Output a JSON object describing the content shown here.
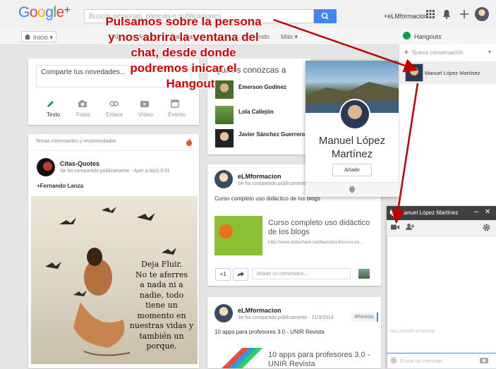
{
  "top": {
    "logo_text": "Google+",
    "search_placeholder": "Buscar personas, páginas o publicaciones",
    "username": "+eLMformacion"
  },
  "nav": {
    "home_label": "Inicio",
    "tabs": [
      "Todos",
      "Amigos",
      "Familia",
      "Conocidos",
      "Siguiendo",
      "Más"
    ],
    "hangouts_title": "Hangouts"
  },
  "compose": {
    "placeholder": "Comparte tus novedades...",
    "actions": [
      "Texto",
      "Fotos",
      "Enlace",
      "Vídeo",
      "Evento"
    ]
  },
  "trending": {
    "header": "Temas interesantes y recomendados",
    "author": "Citas-Quotes",
    "meta": "Se ha compartido públicamente · Ayer a la(s) 3:31",
    "mention": "+Fernando Lanza",
    "poem": [
      "Deja Fluir.",
      "No te aferres",
      "a nada ni a",
      "nadie, todo",
      "tiene un",
      "momento en",
      "nuestras vidas y",
      "también un",
      "porque."
    ]
  },
  "suggestions": {
    "title": "Quizás conozcas a",
    "people": [
      "Emerson Godínez",
      "Lola Callejón",
      "Javier Sánchez Guerrero"
    ]
  },
  "profile_card": {
    "name_line1": "Manuel López",
    "name_line2": "Martínez",
    "add_button": "Añadir"
  },
  "post1": {
    "author": "eLMformacion",
    "meta": "Se ha compartido públicamente",
    "text": "Curso completo uso didáctico de los blogs",
    "link_title": "Curso completo uso didáctico de los blogs",
    "link_url": "http://www.slideshare.net/taucolo14/curso-co...",
    "plus": "+1",
    "comment_placeholder": "Añade un comentario..."
  },
  "post2": {
    "author": "eLMformacion",
    "meta": "Se ha compartido públicamente · 21/3/2014",
    "tag": "#Revista",
    "text": "10 apps para profesores 3.0 - UNIR Revista",
    "link_title": "10 apps para profesores 3.0 - UNIR Revista"
  },
  "hangouts": {
    "new_conversation": "Nueva conversación",
    "contact": "Manuel López Martínez",
    "chat_title": "Manuel López Martínez",
    "history_note": "Has activado el historial",
    "message_placeholder": "Envía un mensaje..."
  },
  "annotation": {
    "lines": [
      "Pulsamos sobre la persona",
      "y nos abrira la ventana del",
      "chat, desde donde",
      "podremos inicar el",
      "Hangout"
    ],
    "color": "#d40000"
  },
  "colors": {
    "accent": "#4285f4",
    "green": "#0f9d58",
    "red": "#dd4b39",
    "chat_header": "#404040"
  }
}
